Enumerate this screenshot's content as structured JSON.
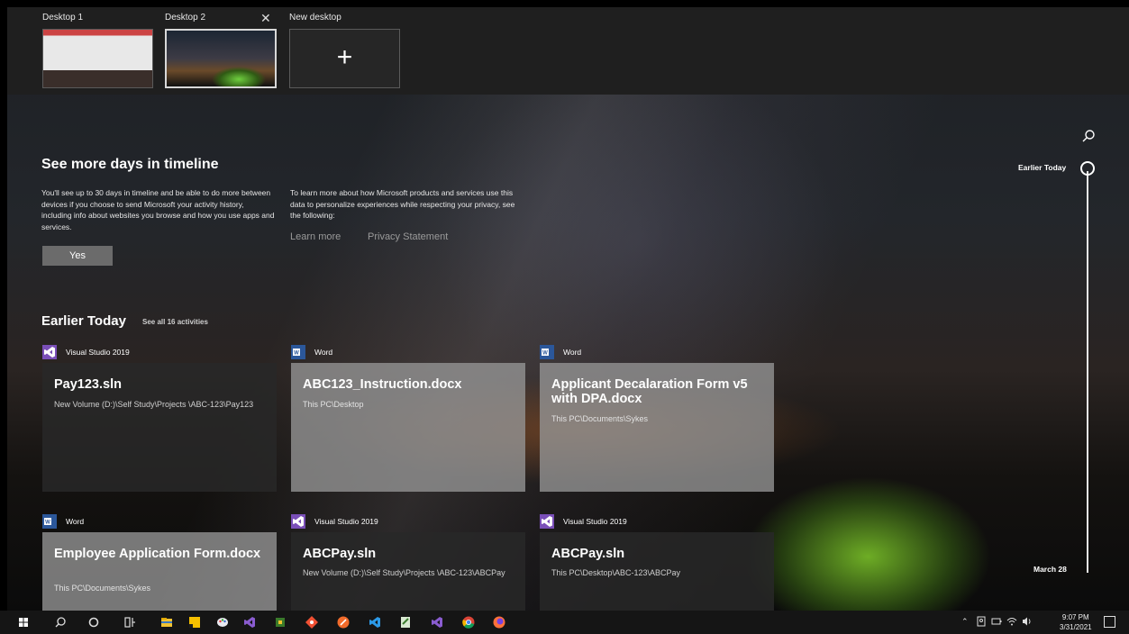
{
  "desktops": {
    "items": [
      {
        "label": "Desktop 1"
      },
      {
        "label": "Desktop 2"
      }
    ],
    "new_label": "New desktop",
    "new_icon": "plus-icon",
    "close_icon": "close-icon"
  },
  "banner": {
    "title": "See more days in timeline",
    "left_text": "You'll see up to 30 days in timeline and be able to do more between devices if you choose to send Microsoft your activity history, including info about websites you browse and how you use apps and services.",
    "right_text": "To learn more about how Microsoft products and services use this data to personalize experiences while respecting your privacy, see the following:",
    "learn_more": "Learn more",
    "privacy": "Privacy Statement",
    "yes_button": "Yes"
  },
  "section": {
    "title": "Earlier Today",
    "see_all": "See all 16 activities"
  },
  "cards": [
    {
      "app": "Visual Studio 2019",
      "app_icon": "visual-studio-icon",
      "title": "Pay123.sln",
      "path": "New Volume (D:)\\Self Study\\Projects \\ABC-123\\Pay123"
    },
    {
      "app": "Word",
      "app_icon": "word-icon",
      "title": "ABC123_Instruction.docx",
      "path": "This PC\\Desktop"
    },
    {
      "app": "Word",
      "app_icon": "word-icon",
      "title": "Applicant Decalaration Form v5 with DPA.docx",
      "path": "This PC\\Documents\\Sykes"
    },
    {
      "app": "Word",
      "app_icon": "word-icon",
      "title": "Employee Application Form.docx",
      "path": "This PC\\Documents\\Sykes"
    },
    {
      "app": "Visual Studio 2019",
      "app_icon": "visual-studio-icon",
      "title": "ABCPay.sln",
      "path": "New Volume (D:)\\Self Study\\Projects \\ABC-123\\ABCPay"
    },
    {
      "app": "Visual Studio 2019",
      "app_icon": "visual-studio-icon",
      "title": "ABCPay.sln",
      "path": "This PC\\Desktop\\ABC-123\\ABCPay"
    }
  ],
  "timeline": {
    "top_label": "Earlier Today",
    "bottom_label": "March 28",
    "search_icon": "search-icon"
  },
  "taskbar": {
    "icons": [
      "start-icon",
      "search-icon",
      "cortana-icon",
      "task-view-icon",
      "file-explorer-icon",
      "sticky-notes-icon",
      "paint-icon",
      "visual-studio-icon",
      "app-icon",
      "git-icon",
      "app-icon",
      "vscode-icon",
      "notepad-icon",
      "visual-studio-icon",
      "chrome-icon",
      "firefox-icon"
    ],
    "time": "9:07 PM",
    "date": "3/31/2021"
  },
  "colors": {
    "vs_purple": "#7a4fb8",
    "word_blue": "#2b579a",
    "tent_green": "#78be28"
  }
}
